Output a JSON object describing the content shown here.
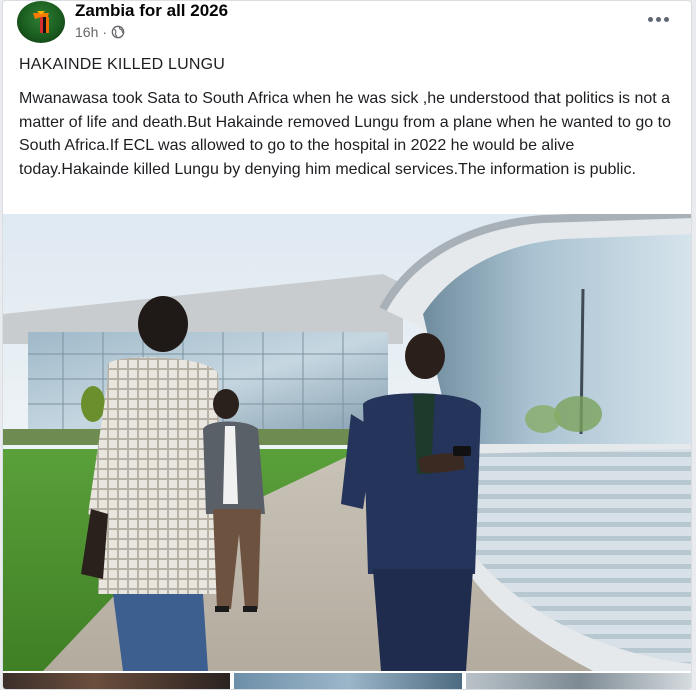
{
  "post": {
    "page_name": "Zambia for all 2026",
    "time": "16h",
    "separator": "·",
    "title": "HAKAINDE KILLED LUNGU",
    "body": "Mwanawasa took Sata to South Africa when he was sick ,he understood that politics is not a matter of life and death.But Hakainde removed Lungu from a plane when he wanted to go to South Africa.If ECL was allowed to go to the hospital in 2022 he would be alive today.Hakainde killed Lungu by denying him medical services.The information is public."
  },
  "icons": {
    "avatar": "flag-avatar-icon",
    "privacy": "globe-icon",
    "menu": "more-horizontal-icon"
  },
  "colors": {
    "text": "#1c1e21",
    "meta": "#65676b",
    "card_bg": "#ffffff",
    "page_bg": "#e9ebee"
  }
}
